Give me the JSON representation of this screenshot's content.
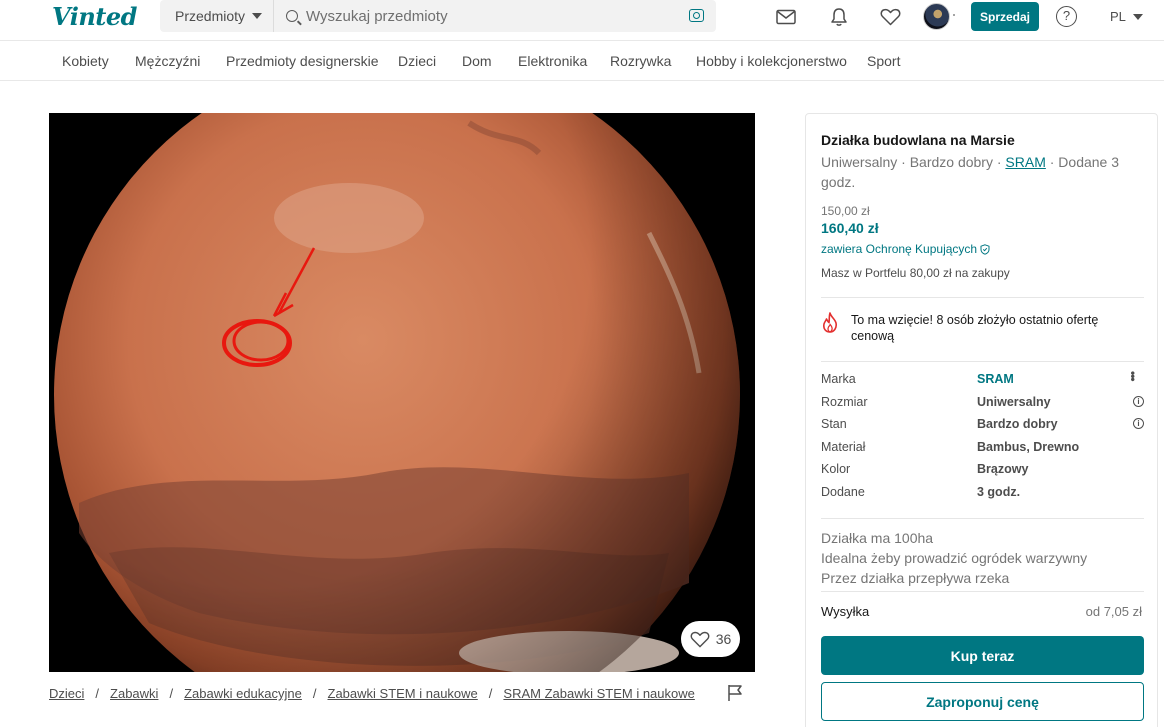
{
  "header": {
    "logo": "Vinted",
    "category_select": "Przedmioty",
    "search_placeholder": "Wyszukaj przedmioty",
    "sell_label": "Sprzedaj",
    "help_label": "?",
    "language": "PL"
  },
  "categories": [
    "Kobiety",
    "Mężczyźni",
    "Przedmioty designerskie",
    "Dzieci",
    "Dom",
    "Elektronika",
    "Rozrywka",
    "Hobby i kolekcjonerstwo",
    "Sport"
  ],
  "photo": {
    "like_count": "36"
  },
  "breadcrumbs": [
    "Dzieci",
    "Zabawki",
    "Zabawki edukacyjne",
    "Zabawki STEM i naukowe",
    "SRAM Zabawki STEM i naukowe"
  ],
  "item": {
    "title": "Działka budowlana na Marsie",
    "subtitle_prefix": "Uniwersalny · Bardzo dobry · ",
    "subtitle_brand": "SRAM",
    "subtitle_suffix": " · Dodane 3 godz.",
    "old_price": "150,00 zł",
    "price": "160,40 zł",
    "protection": "zawiera Ochronę Kupujących",
    "wallet": "Masz w Portfelu 80,00 zł na zakupy",
    "hot_notice": "To ma wzięcie! 8 osób złożyło ostatnio ofertę cenową",
    "attributes": [
      {
        "key": "Marka",
        "value": "SRAM"
      },
      {
        "key": "Rozmiar",
        "value": "Uniwersalny"
      },
      {
        "key": "Stan",
        "value": "Bardzo dobry"
      },
      {
        "key": "Materiał",
        "value": "Bambus, Drewno"
      },
      {
        "key": "Kolor",
        "value": "Brązowy"
      },
      {
        "key": "Dodane",
        "value": "3 godz."
      }
    ],
    "description": [
      "Działka ma 100ha",
      "Idealna żeby prowadzić ogródek warzywny",
      "Przez działka przepływa rzeka"
    ],
    "shipping_label": "Wysyłka",
    "shipping_value": "od 7,05 zł",
    "buy_label": "Kup teraz",
    "offer_label": "Zaproponuj cenę"
  },
  "colors": {
    "brand": "#007782"
  }
}
